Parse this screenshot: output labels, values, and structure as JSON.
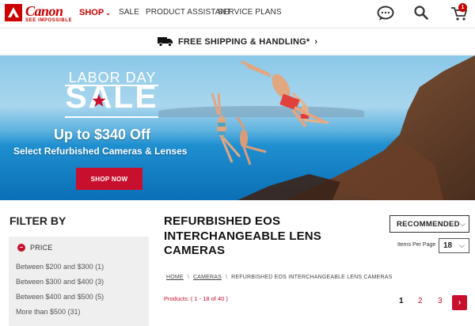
{
  "brand": {
    "name": "Canon",
    "tagline": "SEE IMPOSSIBLE"
  },
  "nav": {
    "shop": "SHOP",
    "items": [
      "SALE",
      "PRODUCT ASSISTANT",
      "SERVICE PLANS"
    ]
  },
  "cart": {
    "count": "1"
  },
  "shipping": {
    "text": "FREE SHIPPING & HANDLING*"
  },
  "hero": {
    "line1": "LABOR DAY",
    "line2": "SALE",
    "offer": "Up to $340 Off",
    "offer_sub": "Select Refurbished Cameras & Lenses",
    "cta": "SHOP NOW"
  },
  "filter": {
    "title": "FILTER BY",
    "price_label": "PRICE",
    "ranges": [
      "Between $200 and $300 (1)",
      "Between $300 and $400 (3)",
      "Between $400 and $500 (5)",
      "More than $500 (31)"
    ]
  },
  "main": {
    "title": "REFURBISHED EOS INTERCHANGEABLE LENS CAMERAS",
    "sort": "RECOMMENDED",
    "items_per_page_label": "Items Per Page",
    "items_per_page": "18",
    "breadcrumb": [
      "HOME",
      "CAMERAS",
      "REFURBISHED EOS INTERCHANGEABLE LENS CAMERAS"
    ],
    "results_label": "Products:",
    "results_range": "( 1 - 18 of 40 )",
    "pages": [
      "1",
      "2",
      "3"
    ],
    "next": "›"
  },
  "colors": {
    "brand_red": "#cc0000",
    "accent_red": "#c8102e"
  }
}
